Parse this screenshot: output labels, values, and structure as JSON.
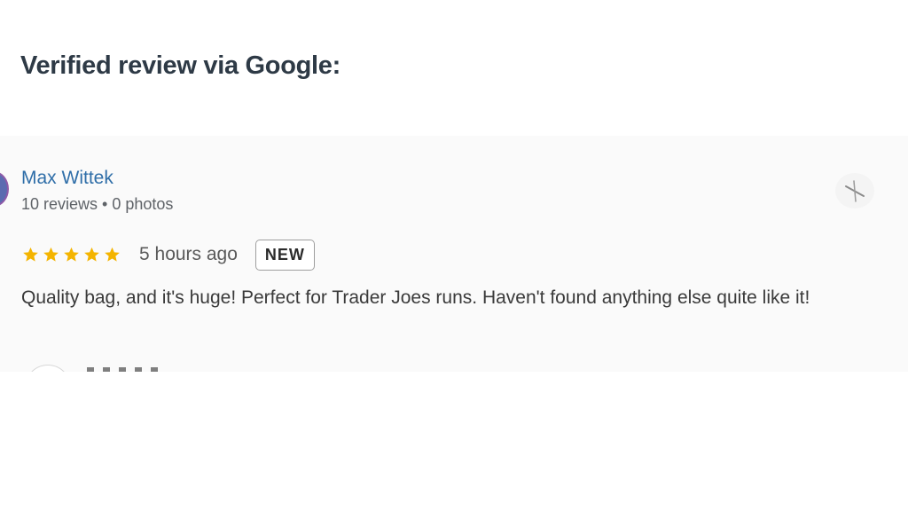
{
  "heading": "Verified review via Google:",
  "review": {
    "reviewer_name": "Max Wittek",
    "reviews_count": "10 reviews",
    "separator": "•",
    "photos_count": "0 photos",
    "rating": 5,
    "rating_max": 5,
    "time_ago": "5 hours ago",
    "badge": "NEW",
    "text": "Quality bag, and it's huge! Perfect for Trader Joes runs. Haven't found anything else quite like it!"
  },
  "icons": {
    "source_icon": "pin-icon",
    "star_icon": "star-icon"
  },
  "colors": {
    "heading": "#2e3a46",
    "reviewer_name": "#2f6ea8",
    "star": "#f4b400",
    "card_background": "#fafafa"
  }
}
